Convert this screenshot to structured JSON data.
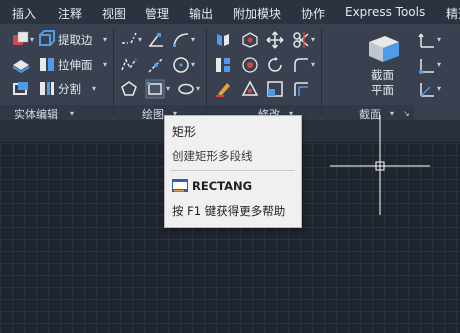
{
  "menubar": {
    "items": [
      "插入",
      "注释",
      "视图",
      "管理",
      "输出",
      "附加模块",
      "协作",
      "Express Tools",
      "精选"
    ]
  },
  "ribbon": {
    "solid_edit": {
      "title": "实体编辑",
      "extract_edges": "提取边",
      "extrude_faces": "拉伸面",
      "separate": "分割"
    },
    "draw": {
      "title": "绘图"
    },
    "modify": {
      "title": "修改"
    },
    "section": {
      "title": "截面",
      "section_plane_line1": "截面",
      "section_plane_line2": "平面"
    }
  },
  "tooltip": {
    "title": "矩形",
    "description": "创建矩形多段线",
    "command": "RECTANG",
    "help": "按 F1 键获得更多帮助"
  },
  "colors": {
    "ribbon_bg": "#394150",
    "canvas_bg": "#1f252e",
    "accent_blue": "#4f9be6",
    "tooltip_bg": "#f0f0f0"
  }
}
